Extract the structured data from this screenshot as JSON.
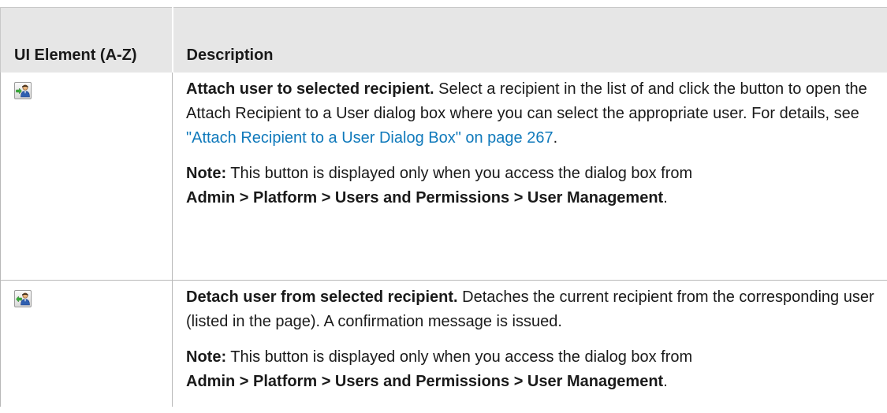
{
  "table": {
    "headers": {
      "ui_element": "UI Element (A-Z)",
      "description": "Description"
    },
    "rows": [
      {
        "icon": "attach-user-icon",
        "title": "Attach user to selected recipient.",
        "text_before_link": " Select a recipient in the list of and click the button to open the Attach Recipient to a User dialog box where you can select the appropriate user. For details, see ",
        "link": "\"Attach Recipient to a User Dialog Box\" on page 267",
        "text_after_link": ".",
        "note_label": "Note:",
        "note_text": " This button is displayed only when you access the dialog box from",
        "note_path": "Admin > Platform > Users and Permissions > User Management",
        "note_end": "."
      },
      {
        "icon": "detach-user-icon",
        "title": "Detach user from selected recipient.",
        "text": " Detaches the current recipient from the corresponding user (listed in the page). A confirmation message is issued.",
        "note_label": "Note:",
        "note_text": " This button is displayed only when you access the dialog box from",
        "note_path": "Admin > Platform > Users and Permissions > User Management",
        "note_end": "."
      }
    ]
  },
  "colors": {
    "header_bg": "#e6e6e6",
    "link": "#0f79bb",
    "border": "#b8b8b8"
  }
}
